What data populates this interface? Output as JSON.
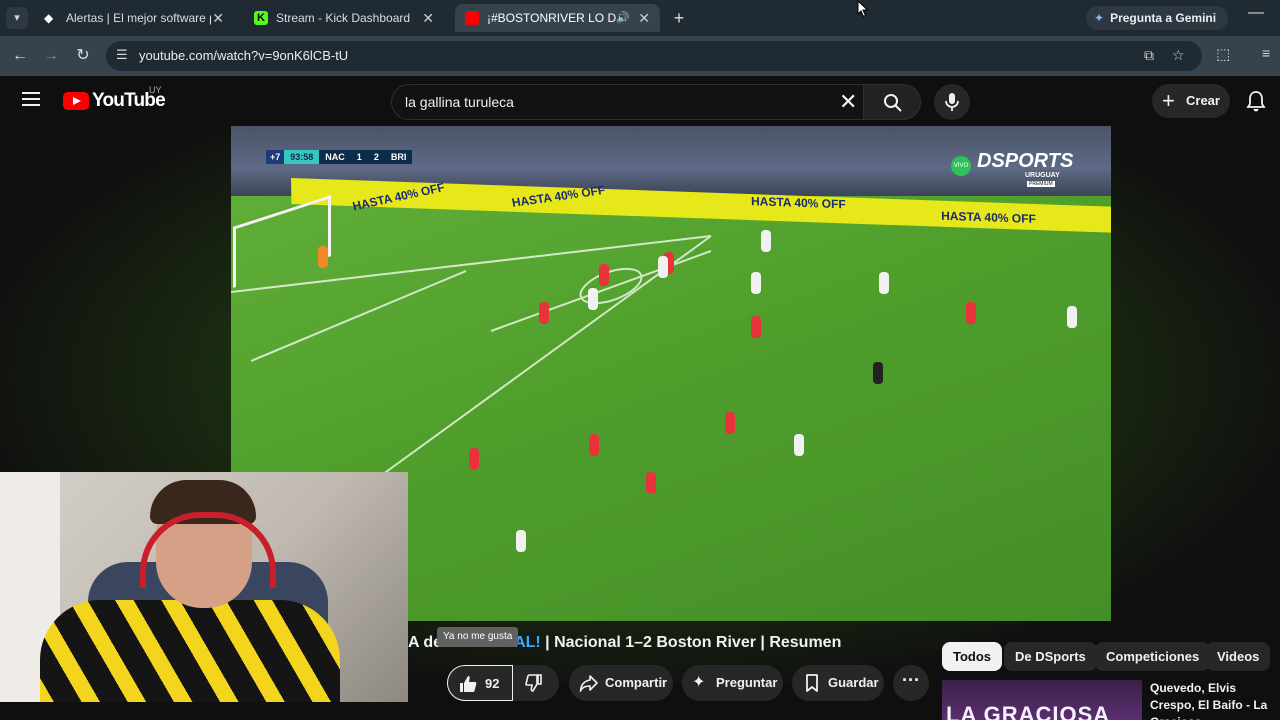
{
  "browser": {
    "tabs": [
      {
        "title": "Alertas | El mejor software para",
        "favicon_color": "#ffffff"
      },
      {
        "title": "Stream - Kick Dashboard",
        "favicon_color": "#53fc18"
      },
      {
        "title": "¡#BOSTONRIVER LO DIO VU",
        "favicon_color": "#ff0000",
        "active": true
      }
    ],
    "gemini_label": "Pregunta a Gemini",
    "url": "youtube.com/watch?v=9onK6lCB-tU"
  },
  "youtube": {
    "logo_text": "YouTube",
    "country_code": "UY",
    "search_value": "la gallina turuleca",
    "create_label": "Crear"
  },
  "video_overlay": {
    "scorebug": {
      "added_time": "+7",
      "clock": "93:58",
      "home": "NAC",
      "home_score": "1",
      "away_score": "2",
      "away": "BRI"
    },
    "ad_text": "HASTA 40% OFF",
    "broadcaster": {
      "live": "VIVO",
      "brand": "DSPORTS",
      "region": "URUGUAY",
      "tier": "PREMIUM"
    }
  },
  "watch": {
    "title_prefix": "A de",
    "title_highlight": "AL!",
    "title_rest": " | Nacional 1–2 Boston River | Resumen",
    "tooltip": "Ya no me gusta",
    "like_count": "92",
    "actions": {
      "share": "Compartir",
      "ask": "Preguntar",
      "save": "Guardar"
    },
    "chips": [
      "Todos",
      "De DSports",
      "Competiciones",
      "Videos"
    ],
    "recommendation": {
      "title": "Quevedo, Elvis Crespo, El Baifo - La Graciosa ...",
      "thumb_text": "LA GRACIOSA"
    }
  }
}
